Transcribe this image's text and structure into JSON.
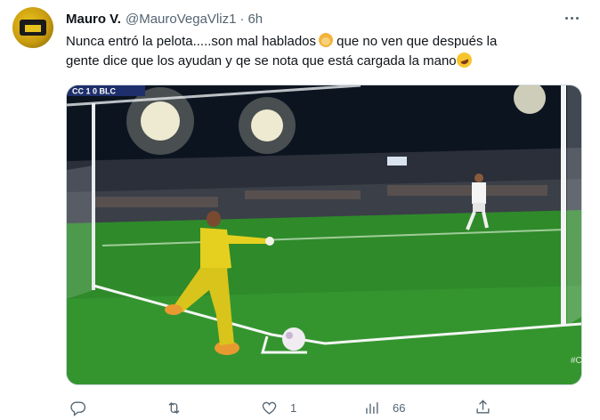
{
  "tweet": {
    "display_name": "Mauro V.",
    "handle": "@MauroVegaVliz1",
    "separator": "·",
    "time": "6h",
    "text_line1": "Nunca entró la pelota.....son mal hablados",
    "text_line1_after": " que no ven que después la",
    "text_line2": "gente dice que los ayudan y qe se nota que está cargada la mano",
    "emoji1": "woman-shrugging-emoji",
    "emoji2": "rolling-laughing-emoji"
  },
  "media": {
    "scoreboard": "CC 1 0 BLC",
    "corner_text": "#C"
  },
  "actions": {
    "reply_count": "",
    "retweet_count": "",
    "like_count": "1",
    "views_count": "66"
  },
  "colors": {
    "text": "#0f1419",
    "secondary": "#536471",
    "pitch": "#2f8a2a",
    "keeper": "#e5d020"
  }
}
